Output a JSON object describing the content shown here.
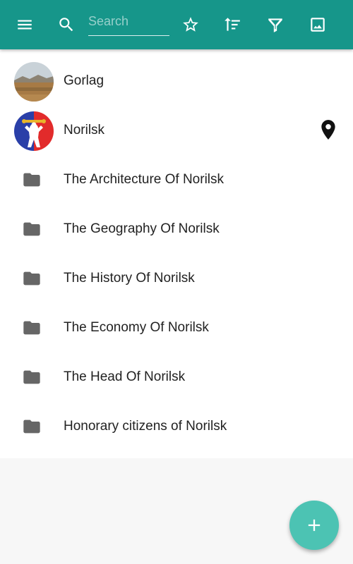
{
  "toolbar": {
    "color": "#16968a",
    "menu_icon": "menu-icon",
    "search_icon": "search-icon",
    "search_placeholder": "Search",
    "search_value": "",
    "actions": [
      "star-icon",
      "sort-icon",
      "filter-icon",
      "image-icon"
    ]
  },
  "list": {
    "items": [
      {
        "label": "Gorlag",
        "icon": "landscape-avatar",
        "trailing": ""
      },
      {
        "label": "Norilsk",
        "icon": "coat-of-arms-avatar",
        "trailing": "map-pin-icon"
      },
      {
        "label": "The Architecture Of Norilsk",
        "icon": "folder-icon"
      },
      {
        "label": "The Geography Of Norilsk",
        "icon": "folder-icon"
      },
      {
        "label": "The History Of Norilsk",
        "icon": "folder-icon"
      },
      {
        "label": "The Economy Of Norilsk",
        "icon": "folder-icon"
      },
      {
        "label": "The Head Of Norilsk",
        "icon": "folder-icon"
      },
      {
        "label": "Honorary citizens of Norilsk",
        "icon": "folder-icon"
      }
    ]
  },
  "fab": {
    "icon": "plus-icon",
    "color": "#4cc3b3"
  }
}
